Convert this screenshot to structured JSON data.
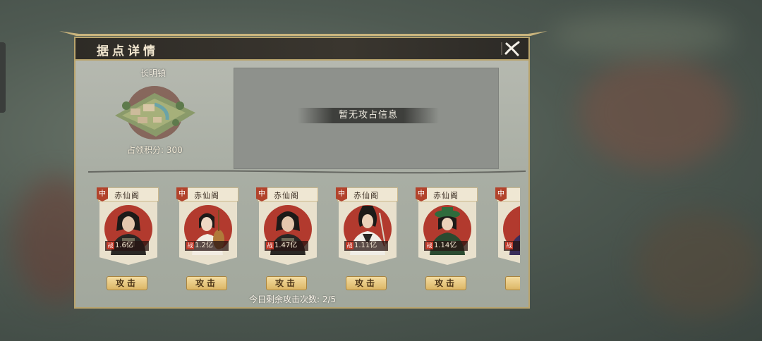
{
  "dialog": {
    "title": "据点详情",
    "town": {
      "name": "长明镇",
      "score_label": "占领积分: 300"
    },
    "info_message": "暂无攻占信息",
    "remaining_attacks": "今日剩余攻击次数: 2/5"
  },
  "cards": [
    {
      "tag": "中",
      "guild": "赤仙阁",
      "power": "1.6亿",
      "attack_label": "攻击",
      "icon": "warrior-armored-portrait"
    },
    {
      "tag": "中",
      "guild": "赤仙阁",
      "power": "1.2亿",
      "attack_label": "攻击",
      "icon": "pipa-maiden-portrait"
    },
    {
      "tag": "中",
      "guild": "赤仙阁",
      "power": "1.47亿",
      "attack_label": "攻击",
      "icon": "warrior-armored-portrait"
    },
    {
      "tag": "中",
      "guild": "赤仙阁",
      "power": "1.11亿",
      "attack_label": "攻击",
      "icon": "swordsman-white-portrait"
    },
    {
      "tag": "中",
      "guild": "赤仙阁",
      "power": "1.14亿",
      "attack_label": "攻击",
      "icon": "green-hat-portrait"
    },
    {
      "tag": "中",
      "guild": "",
      "power": "",
      "attack_label": "",
      "icon": "partial-portrait"
    }
  ],
  "power_icon_text": "战",
  "colors": {
    "accent": "#b9a46d",
    "title_bar": "#2e2b26",
    "tag_red": "#b2432c",
    "button_gold": "#dcb666"
  }
}
